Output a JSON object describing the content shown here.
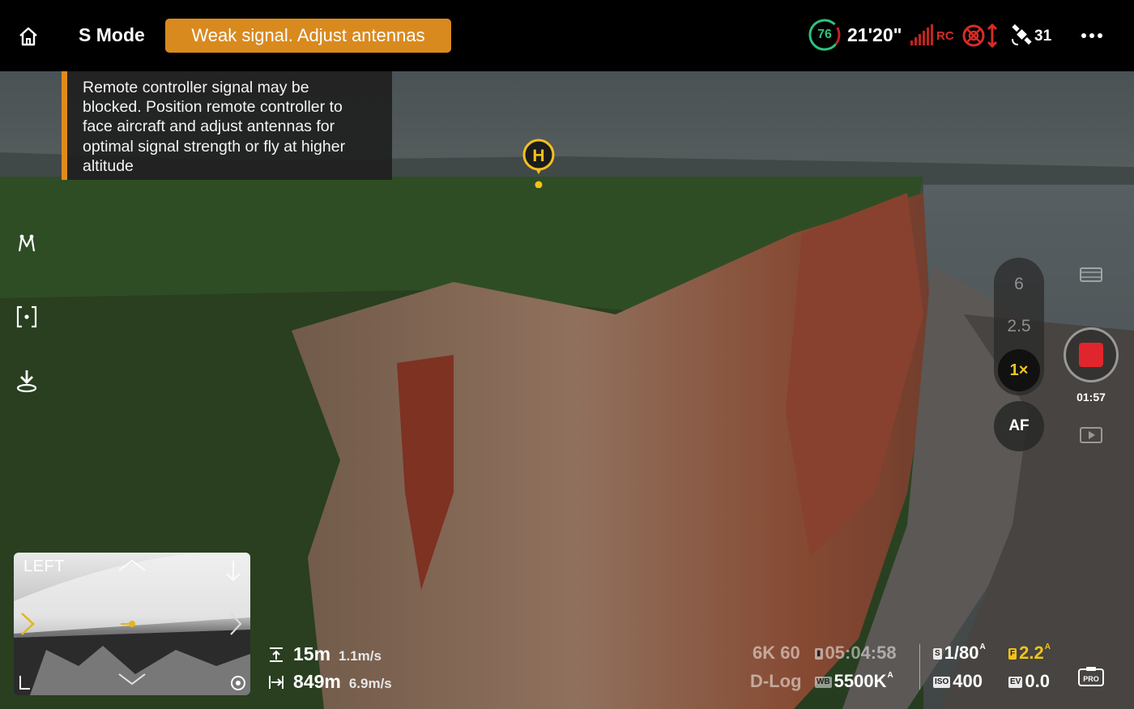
{
  "topbar": {
    "mode": "S Mode",
    "warning": "Weak signal. Adjust antennas",
    "battery_percent": "76",
    "flight_time": "21'20\"",
    "rc_label": "RC",
    "gps_count": "31"
  },
  "tooltip": {
    "lines": [
      "Remote controller signal may be",
      "blocked. Position remote controller to",
      "face aircraft and adjust antennas for",
      "optimal signal strength or fly at higher",
      "altitude"
    ]
  },
  "home_point": {
    "label": "H"
  },
  "zoom": {
    "options": [
      "6",
      "2.5"
    ],
    "active": "1×",
    "af_label": "AF"
  },
  "record": {
    "time": "01:57"
  },
  "minimap": {
    "label": "LEFT"
  },
  "telemetry": {
    "altitude": "15m",
    "vertical_speed": "1.1m/s",
    "distance": "849m",
    "horizontal_speed": "6.9m/s"
  },
  "camera": {
    "resolution_fps": "6K 60",
    "remaining_time": "05:04:58",
    "color_profile": "D-Log",
    "white_balance": "5500K",
    "wb_mark": "A",
    "shutter": "1/80",
    "shutter_mark": "A",
    "aperture": "2.2",
    "aperture_mark": "A",
    "iso": "400",
    "ev": "0.0",
    "tags": {
      "shutter": "S",
      "aperture": "F",
      "wb": "WB",
      "iso": "ISO",
      "ev": "EV"
    },
    "pro_label": "PRO"
  },
  "colors": {
    "accent_orange": "#d98a1f",
    "battery_green": "#2ec27e",
    "rc_red": "#d92b25",
    "zoom_gold": "#f2c51a",
    "record_red": "#e0262c"
  },
  "icons": {
    "home": "home-icon",
    "obstacle": "obstacle-warning-icon",
    "gps": "satellite-icon",
    "more": "more-icon",
    "waypoint": "waypoint-route-icon",
    "focus": "focus-frame-icon",
    "landing": "landing-icon"
  }
}
